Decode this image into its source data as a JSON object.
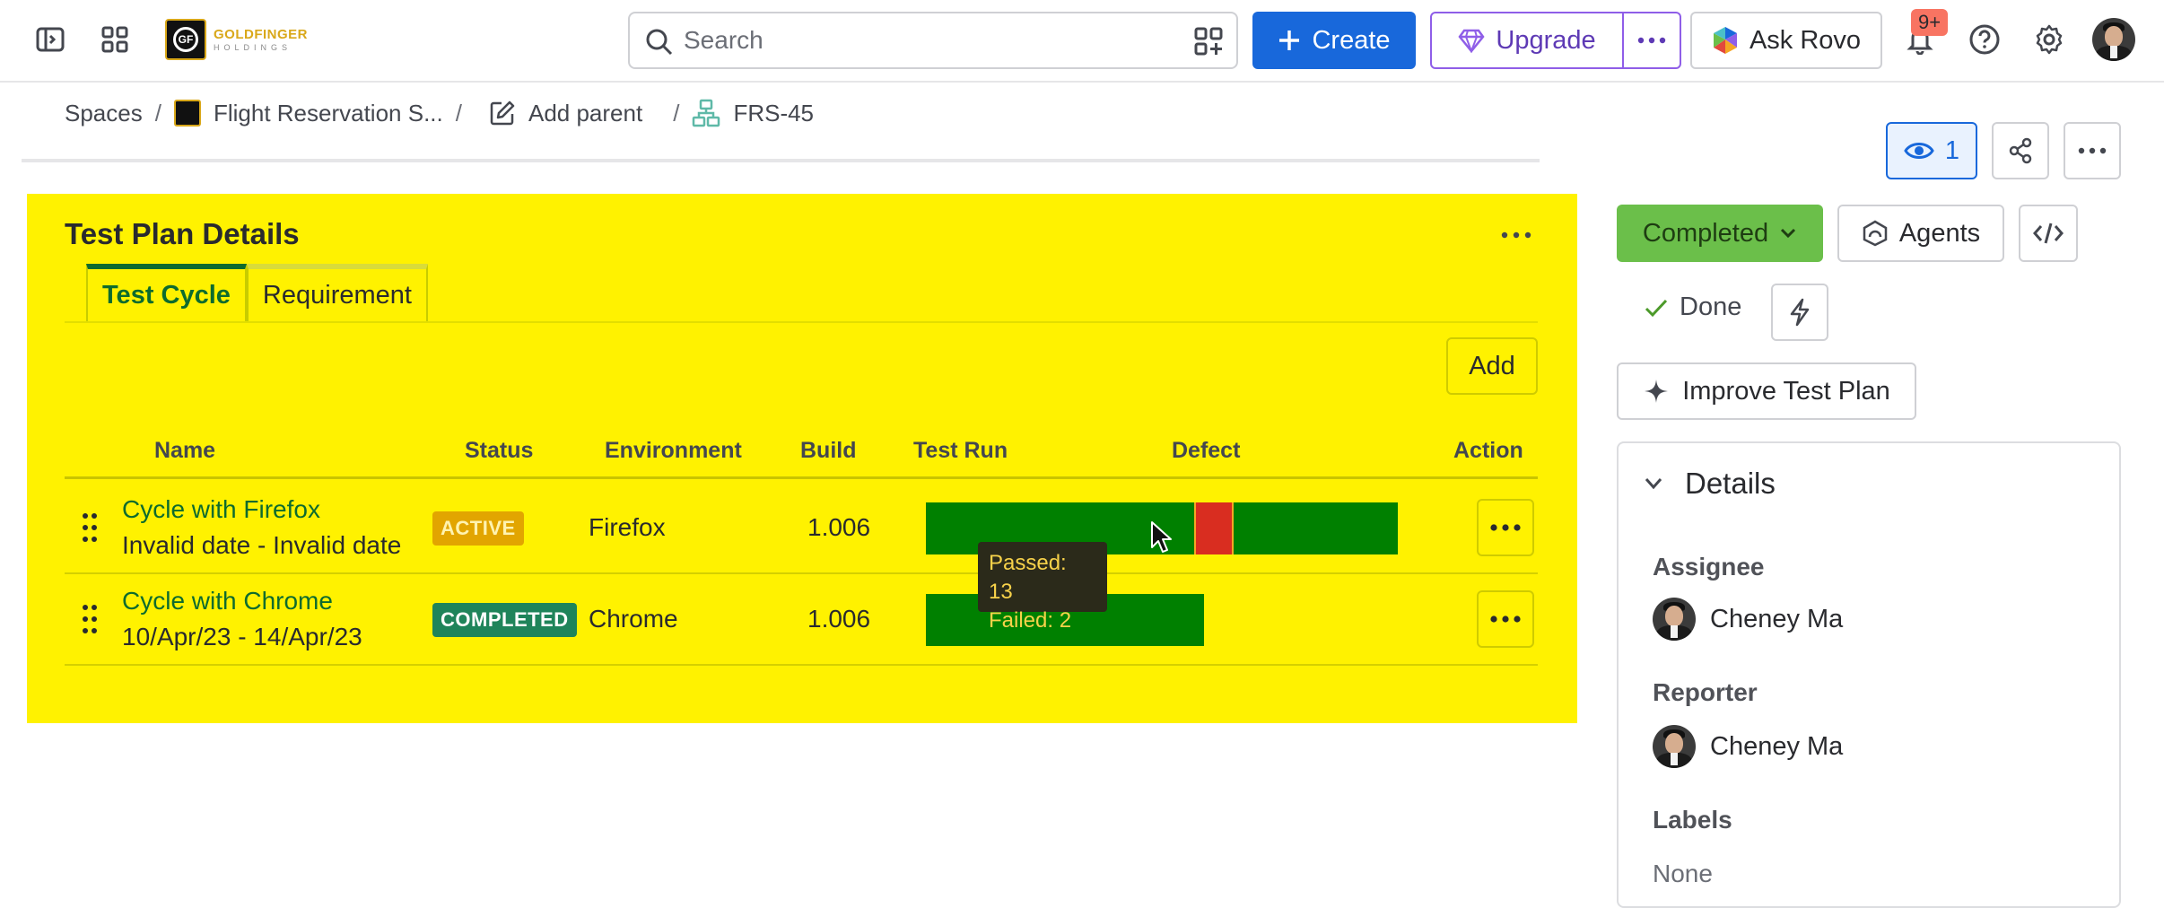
{
  "topbar": {
    "logo_text": "GOLDFINGER",
    "logo_subtext": "HOLDINGS",
    "logo_mark": "GF",
    "search_placeholder": "Search",
    "create_label": "Create",
    "upgrade_label": "Upgrade",
    "ask_rovo_label": "Ask Rovo",
    "notifications_badge": "9+",
    "accent_color": "#1868db"
  },
  "breadcrumb": {
    "spaces": "Spaces",
    "project": "Flight Reservation S...",
    "add_parent": "Add parent",
    "issue_key": "FRS-45"
  },
  "page_actions": {
    "watch_count": "1"
  },
  "test_plan": {
    "title": "Test Plan Details",
    "tabs": [
      {
        "label": "Test Cycle",
        "active": true
      },
      {
        "label": "Requirement",
        "active": false
      }
    ],
    "add_label": "Add",
    "columns": [
      "Name",
      "Status",
      "Environment",
      "Build",
      "Test Run",
      "Defect",
      "Action"
    ],
    "rows": [
      {
        "name": "Cycle with Firefox",
        "dates": "Invalid date - Invalid date",
        "status": "ACTIVE",
        "environment": "Firefox",
        "build": "1.006",
        "test_run": {
          "passed": 13,
          "failed": 2
        }
      },
      {
        "name": "Cycle with Chrome",
        "dates": "10/Apr/23 - 14/Apr/23",
        "status": "COMPLETED",
        "environment": "Chrome",
        "build": "1.006",
        "test_run": {
          "passed": 10,
          "failed": 0
        }
      }
    ],
    "tooltip": {
      "passed": "Passed: 13",
      "failed": "Failed: 2"
    },
    "panel_color": "#fff200",
    "pass_color": "#008000",
    "fail_color": "#d92d20"
  },
  "sidebar": {
    "status_label": "Completed",
    "agents_label": "Agents",
    "done_label": "Done",
    "improve_label": "Improve Test Plan",
    "details": {
      "header": "Details",
      "assignee_label": "Assignee",
      "assignee": "Cheney Ma",
      "reporter_label": "Reporter",
      "reporter": "Cheney Ma",
      "labels_label": "Labels",
      "labels_value": "None"
    }
  }
}
